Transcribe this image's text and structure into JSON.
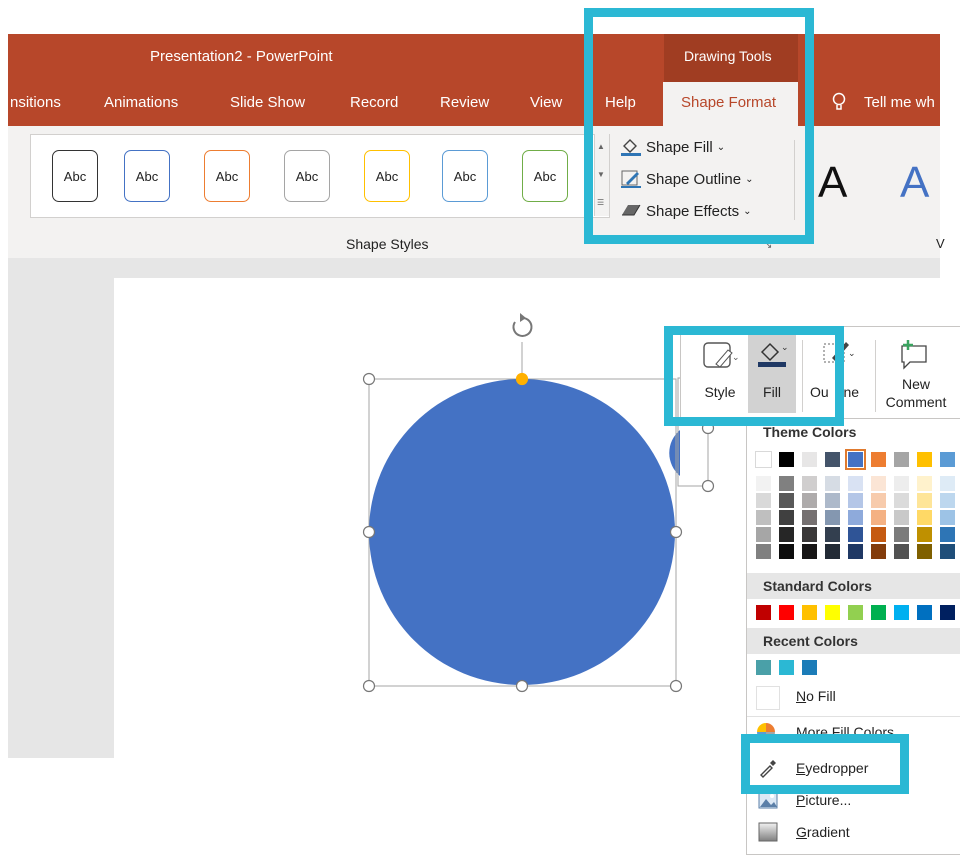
{
  "window": {
    "title": "Presentation2  -  PowerPoint",
    "context_tab": "Drawing Tools"
  },
  "tabs": [
    {
      "label": "nsitions"
    },
    {
      "label": "Animations"
    },
    {
      "label": "Slide Show"
    },
    {
      "label": "Record"
    },
    {
      "label": "Review"
    },
    {
      "label": "View"
    },
    {
      "label": "Help"
    },
    {
      "label": "Shape Format",
      "active": true
    },
    {
      "label": "Tell me wh"
    }
  ],
  "ribbon": {
    "style_gallery": [
      "Abc",
      "Abc",
      "Abc",
      "Abc",
      "Abc",
      "Abc",
      "Abc"
    ],
    "style_gallery_colors": [
      "#333333",
      "#4472c4",
      "#ed7d31",
      "#a5a5a5",
      "#ffc000",
      "#5b9bd5",
      "#70ad47"
    ],
    "group_label": "Shape Styles",
    "shape_fill": "Shape Fill",
    "shape_outline": "Shape Outline",
    "shape_effects": "Shape Effects",
    "wordart_sample": "A",
    "right_group_label": "V"
  },
  "mini_toolbar": {
    "style": "Style",
    "fill": "Fill",
    "outline": "Ou   ine",
    "new_comment_1": "New",
    "new_comment_2": "Comment"
  },
  "fill_menu": {
    "theme_header": "Theme Colors",
    "standard_header": "Standard Colors",
    "recent_header": "Recent Colors",
    "theme_top": [
      "#ffffff",
      "#000000",
      "#e7e6e6",
      "#44546a",
      "#4472c4",
      "#ed7d31",
      "#a5a5a5",
      "#ffc000",
      "#5b9bd5"
    ],
    "theme_shades": [
      [
        "#f2f2f2",
        "#d9d9d9",
        "#bfbfbf",
        "#a6a6a6",
        "#808080"
      ],
      [
        "#808080",
        "#595959",
        "#404040",
        "#262626",
        "#0d0d0d"
      ],
      [
        "#d0cece",
        "#aeabab",
        "#757070",
        "#3a3838",
        "#171616"
      ],
      [
        "#d6dce4",
        "#adb9ca",
        "#8497b0",
        "#333f4f",
        "#222a35"
      ],
      [
        "#d9e2f3",
        "#b4c6e7",
        "#8eaadb",
        "#2f5496",
        "#1f3864"
      ],
      [
        "#fbe5d5",
        "#f7cbac",
        "#f4b183",
        "#c55a11",
        "#833c0b"
      ],
      [
        "#ededed",
        "#dbdbdb",
        "#c9c9c9",
        "#7b7b7b",
        "#525252"
      ],
      [
        "#fff2cc",
        "#fee599",
        "#ffd966",
        "#bf9000",
        "#7f6000"
      ],
      [
        "#deebf6",
        "#bdd7ee",
        "#9dc3e6",
        "#2e75b5",
        "#1f4e79"
      ]
    ],
    "standard": [
      "#c00000",
      "#ff0000",
      "#ffc000",
      "#ffff00",
      "#92d050",
      "#00b050",
      "#00b0f0",
      "#0070c0",
      "#002060"
    ],
    "recent": [
      "#4aa0a8",
      "#2bb8d4",
      "#1b7cb8"
    ],
    "no_fill": "No Fill",
    "more_colors": "More Fill Colors...",
    "eyedropper": "Eyedropper",
    "picture": "Picture...",
    "gradient": "Gradient"
  },
  "shape": {
    "fill_color": "#4472c4"
  },
  "highlight_color": "#2bb8d4"
}
